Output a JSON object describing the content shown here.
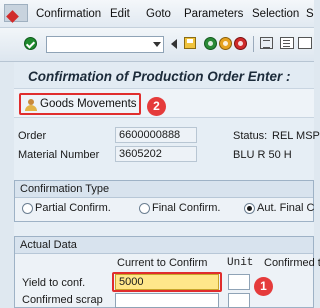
{
  "menu": {
    "items": [
      "Confirmation",
      "Edit",
      "Goto",
      "Parameters",
      "Selection",
      "S"
    ]
  },
  "toolbar": {
    "command_field_value": "",
    "icons": [
      "enter-icon",
      "back-icon",
      "save-icon",
      "exit-icon",
      "up-icon",
      "cancel-icon",
      "print-icon",
      "find-icon",
      "find-next-icon"
    ]
  },
  "title": "Confirmation of Production Order Enter :",
  "app_toolbar": {
    "goods_movements_label": "Goods Movements"
  },
  "callouts": {
    "one": "1",
    "two": "2"
  },
  "header": {
    "order_label": "Order",
    "order_value": "6600000888",
    "status_label": "Status:",
    "status_value": "REL  MSP",
    "material_label": "Material Number",
    "material_value": "3605202",
    "material_desc": "BLU R 50 H"
  },
  "confirmation_type": {
    "title": "Confirmation Type",
    "options": [
      {
        "label": "Partial Confirm.",
        "selected": false
      },
      {
        "label": "Final Confirm.",
        "selected": false
      },
      {
        "label": "Aut. Final C",
        "selected": true
      }
    ]
  },
  "actual_data": {
    "title": "Actual Data",
    "col_current": "Current to Confirm",
    "col_unit": "Unit",
    "col_confirmed": "Confirmed to",
    "yield_label": "Yield to conf.",
    "yield_value": "5000",
    "scrap_label": "Confirmed scrap",
    "scrap_value": ""
  },
  "colors": {
    "highlight_border": "#e02d2d",
    "callout_fill": "#e53b3b",
    "active_input": "#ffe78a"
  }
}
